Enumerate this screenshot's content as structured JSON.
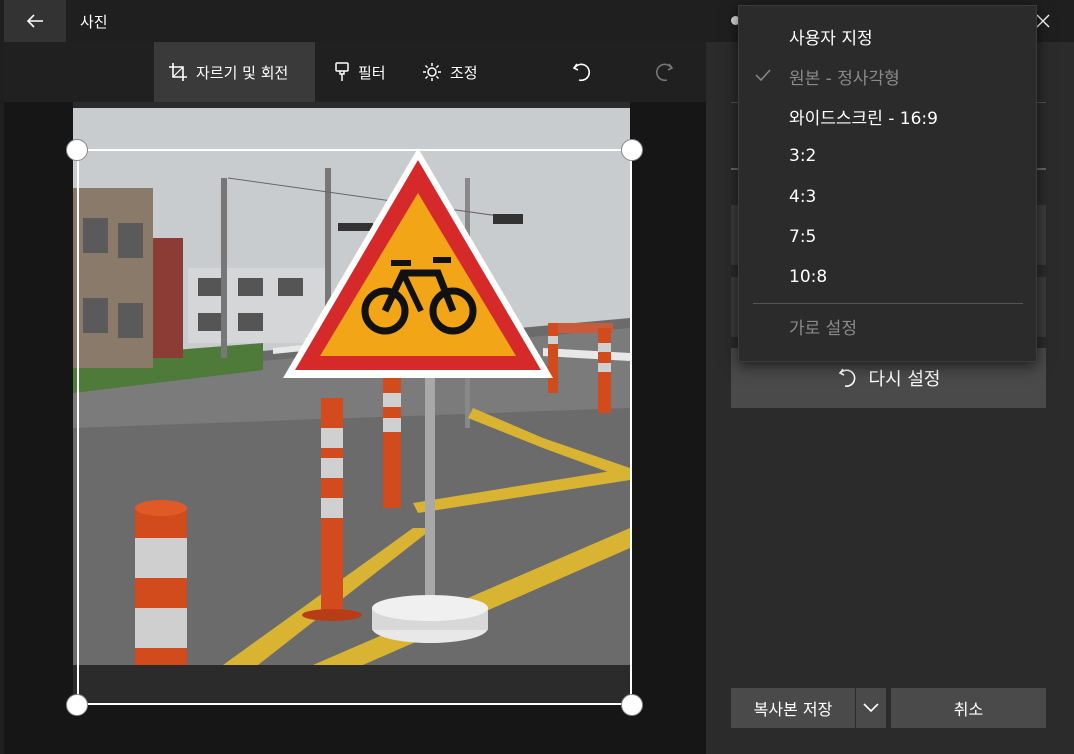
{
  "app": {
    "title": "사진"
  },
  "toolbar": {
    "crop_label": "자르기 및 회전",
    "filter_label": "필터",
    "adjust_label": "조정"
  },
  "panel": {
    "reset_label": "다시 설정"
  },
  "footer": {
    "save_copy_label": "복사본 저장",
    "cancel_label": "취소"
  },
  "aspect_menu": {
    "items": [
      {
        "label": "사용자 지정",
        "checked": false,
        "disabled": false
      },
      {
        "label": "원본 - 정사각형",
        "checked": true,
        "disabled": true
      },
      {
        "label": "와이드스크린 - 16:9",
        "checked": false,
        "disabled": false
      },
      {
        "label": "3:2",
        "checked": false,
        "disabled": false
      },
      {
        "label": "4:3",
        "checked": false,
        "disabled": false
      },
      {
        "label": "7:5",
        "checked": false,
        "disabled": false
      },
      {
        "label": "10:8",
        "checked": false,
        "disabled": false
      }
    ],
    "orientation_label": "가로 설정"
  },
  "icons": {
    "back": "arrow-left-icon",
    "close": "close-icon",
    "crop": "crop-icon",
    "filter": "filter-brush-icon",
    "adjust": "sun-brightness-icon",
    "undo": "undo-icon",
    "redo": "redo-icon",
    "reset": "reset-icon",
    "chevron": "chevron-down-icon",
    "check": "check-icon"
  },
  "colors": {
    "background": "#1f1f1f",
    "panel": "#2b2b2b",
    "button": "#4a4a4a",
    "sign_red": "#d62a2a",
    "sign_yellow": "#f2a516"
  }
}
